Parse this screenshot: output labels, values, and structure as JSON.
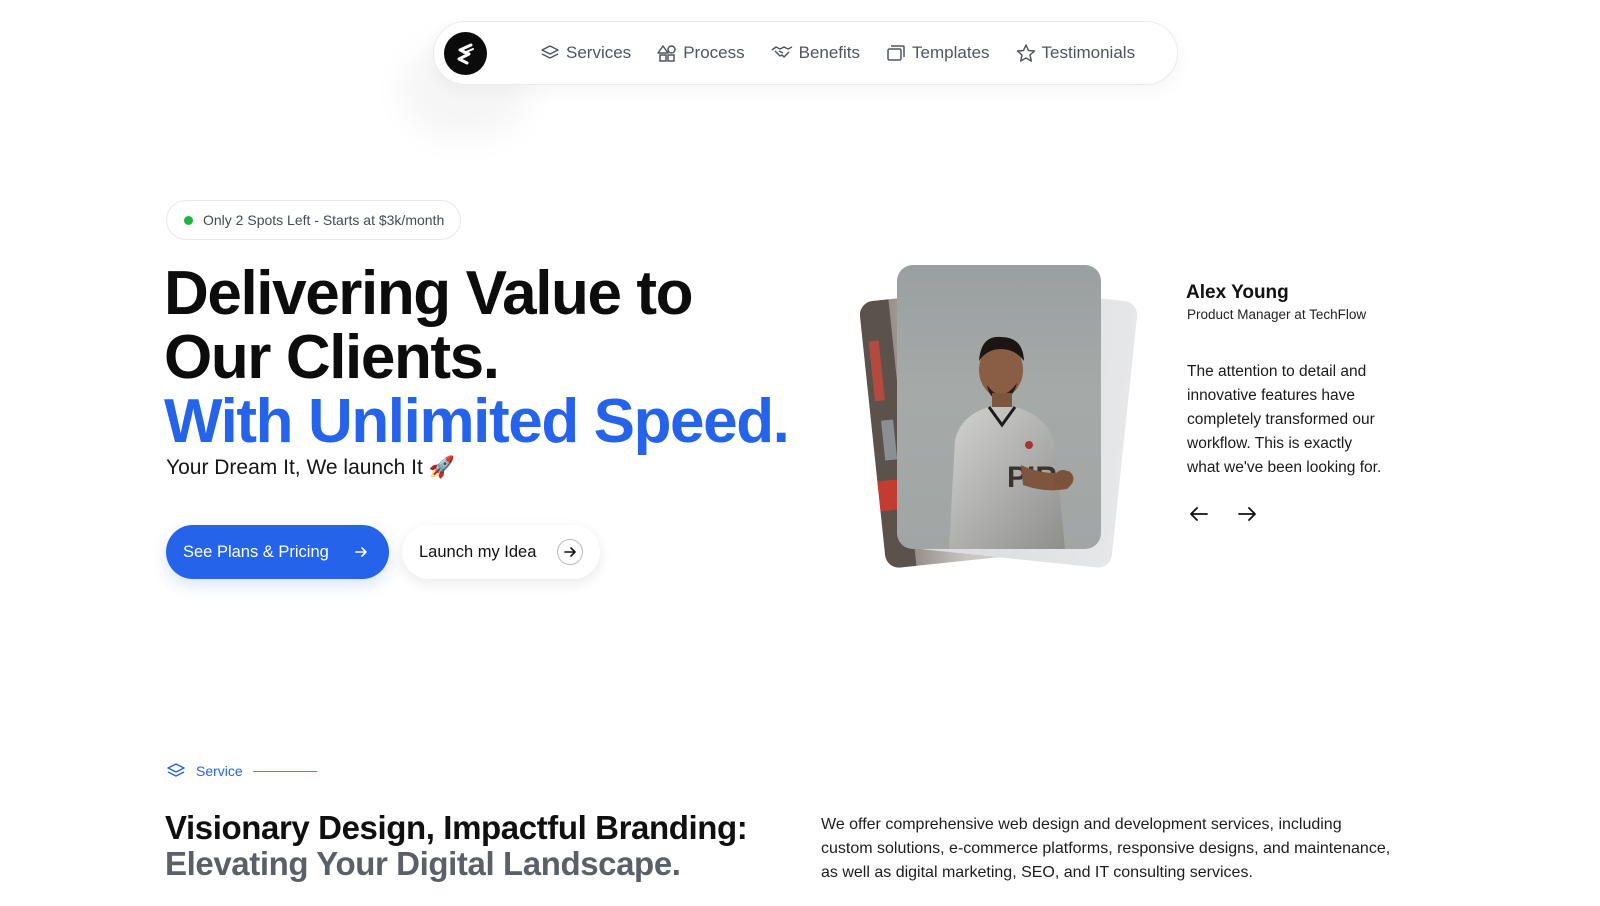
{
  "nav": {
    "items": [
      {
        "label": "Services",
        "icon": "layers-icon"
      },
      {
        "label": "Process",
        "icon": "shapes-icon"
      },
      {
        "label": "Benefits",
        "icon": "handshake-icon"
      },
      {
        "label": "Templates",
        "icon": "copy-icon"
      },
      {
        "label": "Testimonials",
        "icon": "star-icon"
      }
    ]
  },
  "badge": {
    "text": "Only 2 Spots Left - Starts at $3k/month",
    "dot_color": "#1fb341"
  },
  "hero": {
    "title_line1": "Delivering Value to Our Clients.",
    "title_line2": "With Unlimited Speed.",
    "subtitle": "Your Dream It, We launch It 🚀",
    "primary_button": "See Plans & Pricing",
    "secondary_button": "Launch my Idea",
    "accent_color": "#2563eb"
  },
  "testimonial": {
    "name": "Alex Young",
    "role": "Product Manager at TechFlow",
    "quote": "The attention to detail and innovative features have completely transformed our workflow. This is exactly what we've been looking for."
  },
  "service": {
    "label": "Service",
    "title_line1": "Visionary Design, Impactful Branding:",
    "title_line2": "Elevating Your Digital Landscape.",
    "description": "We offer comprehensive web design and development services, including custom solutions, e-commerce platforms, responsive designs, and maintenance, as well as digital marketing, SEO, and IT consulting services."
  }
}
